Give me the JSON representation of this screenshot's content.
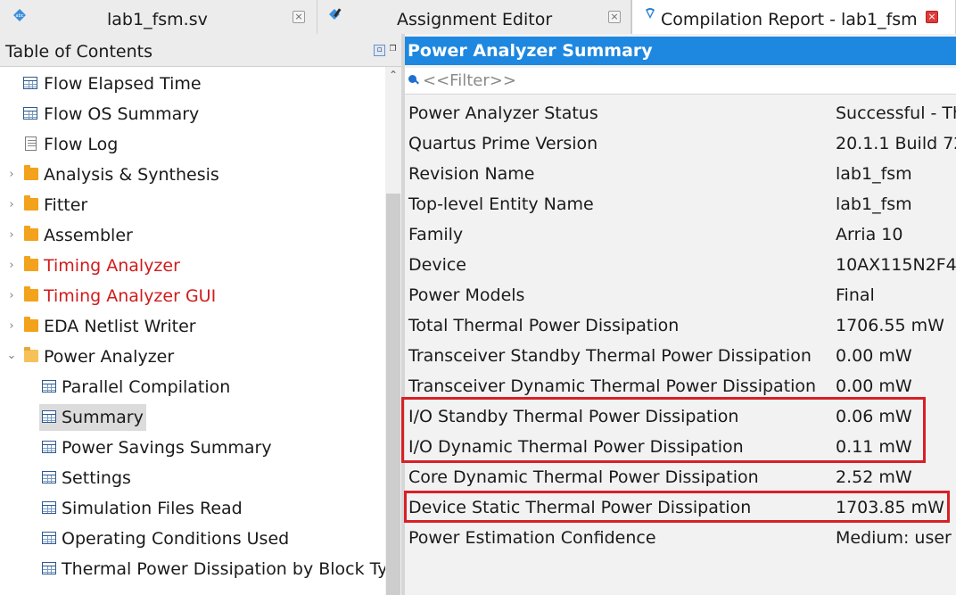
{
  "tabs": [
    {
      "label": "lab1_fsm.sv",
      "icon": "verilog-file-icon"
    },
    {
      "label": "Assignment Editor",
      "icon": "assignment-editor-icon"
    },
    {
      "label": "Compilation Report - lab1_fsm",
      "icon": "compilation-report-icon"
    }
  ],
  "toc": {
    "title": "Table of Contents",
    "items": [
      {
        "label": "Flow Elapsed Time",
        "icon": "table-icon"
      },
      {
        "label": "Flow OS Summary",
        "icon": "table-icon"
      },
      {
        "label": "Flow Log",
        "icon": "document-icon"
      },
      {
        "label": "Analysis & Synthesis",
        "icon": "folder-icon"
      },
      {
        "label": "Fitter",
        "icon": "folder-icon"
      },
      {
        "label": "Assembler",
        "icon": "folder-icon"
      },
      {
        "label": "Timing Analyzer",
        "icon": "folder-icon",
        "color": "#d01c1c"
      },
      {
        "label": "Timing Analyzer GUI",
        "icon": "folder-icon",
        "color": "#d01c1c"
      },
      {
        "label": "EDA Netlist Writer",
        "icon": "folder-icon"
      },
      {
        "label": "Power Analyzer",
        "icon": "folder-open-icon"
      },
      {
        "label": "Parallel Compilation",
        "icon": "table-icon"
      },
      {
        "label": "Summary",
        "icon": "table-icon"
      },
      {
        "label": "Power Savings Summary",
        "icon": "table-icon"
      },
      {
        "label": "Settings",
        "icon": "table-icon"
      },
      {
        "label": "Simulation Files Read",
        "icon": "table-icon"
      },
      {
        "label": "Operating Conditions Used",
        "icon": "table-icon"
      },
      {
        "label": "Thermal Power Dissipation by Block Ty",
        "icon": "table-icon"
      }
    ]
  },
  "report": {
    "title": "Power Analyzer Summary",
    "filter_placeholder": "<<Filter>>",
    "rows": [
      {
        "key": "Power Analyzer Status",
        "value": "Successful - Th"
      },
      {
        "key": "Quartus Prime Version",
        "value": "20.1.1 Build 72"
      },
      {
        "key": "Revision Name",
        "value": "lab1_fsm"
      },
      {
        "key": "Top-level Entity Name",
        "value": "lab1_fsm"
      },
      {
        "key": "Family",
        "value": "Arria 10"
      },
      {
        "key": "Device",
        "value": "10AX115N2F4"
      },
      {
        "key": "Power Models",
        "value": "Final"
      },
      {
        "key": "Total Thermal Power Dissipation",
        "value": "1706.55 mW"
      },
      {
        "key": "Transceiver Standby Thermal Power Dissipation",
        "value": "0.00 mW"
      },
      {
        "key": "Transceiver Dynamic Thermal Power Dissipation",
        "value": "0.00 mW"
      },
      {
        "key": "I/O Standby Thermal Power Dissipation",
        "value": "0.06 mW"
      },
      {
        "key": "I/O Dynamic Thermal Power Dissipation",
        "value": "0.11 mW"
      },
      {
        "key": "Core Dynamic Thermal Power Dissipation",
        "value": "2.52 mW"
      },
      {
        "key": "Device Static Thermal Power Dissipation",
        "value": "1703.85 mW"
      },
      {
        "key": "Power Estimation Confidence",
        "value": "Medium: user"
      }
    ]
  },
  "colors": {
    "accent": "#1e87e0",
    "highlight": "#d81f26",
    "warning_text": "#d01c1c"
  }
}
